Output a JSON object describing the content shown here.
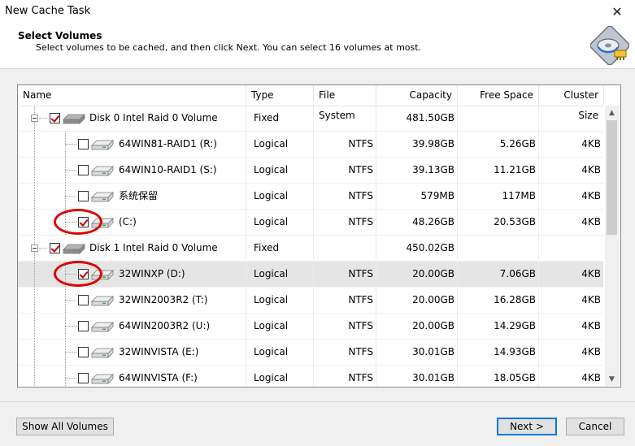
{
  "window": {
    "title": "New Cache Task",
    "close_glyph": "✕"
  },
  "header": {
    "title": "Select Volumes",
    "subtitle": "Select volumes to be cached, and then click Next. You can select 16 volumes at most.",
    "logo_icon": "cache-disk-logo-icon"
  },
  "table": {
    "columns": [
      "Name",
      "Type",
      "File System",
      "Capacity",
      "Free Space",
      "Cluster Size"
    ],
    "rows": [
      {
        "level": 0,
        "checked": true,
        "highlight": false,
        "selected": false,
        "name": "Disk 0 Intel    Raid 0 Volume",
        "type": "Fixed",
        "fs": "",
        "capacity": "481.50GB",
        "free": "",
        "cluster": ""
      },
      {
        "level": 1,
        "checked": false,
        "highlight": false,
        "selected": false,
        "name": "64WIN81-RAID1 (R:)",
        "type": "Logical",
        "fs": "NTFS",
        "capacity": "39.98GB",
        "free": "5.26GB",
        "cluster": "4KB"
      },
      {
        "level": 1,
        "checked": false,
        "highlight": false,
        "selected": false,
        "name": "64WIN10-RAID1 (S:)",
        "type": "Logical",
        "fs": "NTFS",
        "capacity": "39.13GB",
        "free": "11.21GB",
        "cluster": "4KB"
      },
      {
        "level": 1,
        "checked": false,
        "highlight": false,
        "selected": false,
        "name": "系统保留",
        "type": "Logical",
        "fs": "NTFS",
        "capacity": "579MB",
        "free": "117MB",
        "cluster": "4KB"
      },
      {
        "level": 1,
        "checked": true,
        "highlight": true,
        "selected": false,
        "name": "(C:)",
        "type": "Logical",
        "fs": "NTFS",
        "capacity": "48.26GB",
        "free": "20.53GB",
        "cluster": "4KB"
      },
      {
        "level": 0,
        "checked": true,
        "highlight": false,
        "selected": false,
        "name": "Disk 1 Intel    Raid 0 Volume",
        "type": "Fixed",
        "fs": "",
        "capacity": "450.02GB",
        "free": "",
        "cluster": ""
      },
      {
        "level": 1,
        "checked": true,
        "highlight": true,
        "selected": true,
        "name": "32WINXP (D:)",
        "type": "Logical",
        "fs": "NTFS",
        "capacity": "20.00GB",
        "free": "7.06GB",
        "cluster": "4KB"
      },
      {
        "level": 1,
        "checked": false,
        "highlight": false,
        "selected": false,
        "name": "32WIN2003R2 (T:)",
        "type": "Logical",
        "fs": "NTFS",
        "capacity": "20.00GB",
        "free": "16.28GB",
        "cluster": "4KB"
      },
      {
        "level": 1,
        "checked": false,
        "highlight": false,
        "selected": false,
        "name": "64WIN2003R2 (U:)",
        "type": "Logical",
        "fs": "NTFS",
        "capacity": "20.00GB",
        "free": "14.29GB",
        "cluster": "4KB"
      },
      {
        "level": 1,
        "checked": false,
        "highlight": false,
        "selected": false,
        "name": "32WINVISTA (E:)",
        "type": "Logical",
        "fs": "NTFS",
        "capacity": "30.01GB",
        "free": "14.93GB",
        "cluster": "4KB"
      },
      {
        "level": 1,
        "checked": false,
        "highlight": false,
        "selected": false,
        "name": "64WINVISTA (F:)",
        "type": "Logical",
        "fs": "NTFS",
        "capacity": "30.01GB",
        "free": "18.05GB",
        "cluster": "4KB"
      }
    ]
  },
  "scrollbar": {
    "up_glyph": "▲",
    "down_glyph": "▼"
  },
  "footer": {
    "show_all": "Show All Volumes",
    "next": "Next >",
    "cancel": "Cancel"
  },
  "colors": {
    "highlight_circle": "#e00000",
    "check_mark": "#c00000",
    "default_button_border": "#0078d7"
  }
}
